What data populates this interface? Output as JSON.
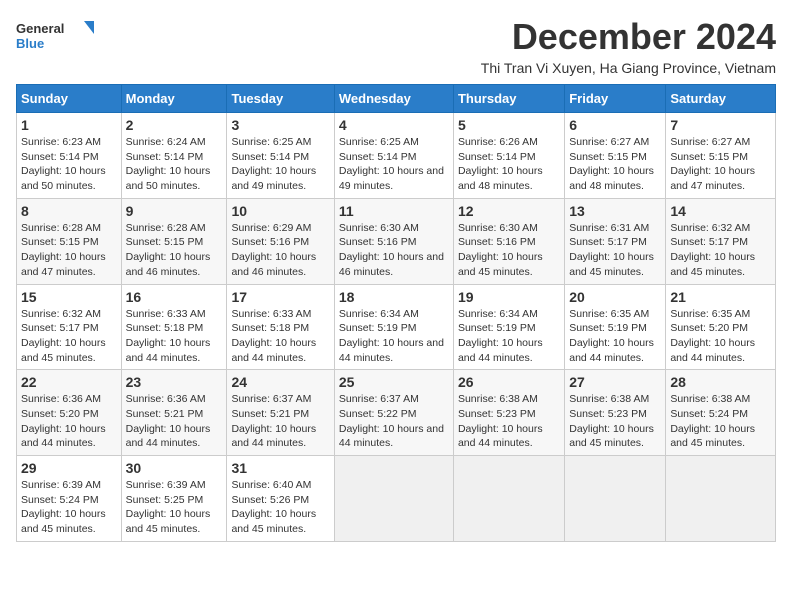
{
  "logo": {
    "text_general": "General",
    "text_blue": "Blue"
  },
  "header": {
    "month_year": "December 2024",
    "location": "Thi Tran Vi Xuyen, Ha Giang Province, Vietnam"
  },
  "weekdays": [
    "Sunday",
    "Monday",
    "Tuesday",
    "Wednesday",
    "Thursday",
    "Friday",
    "Saturday"
  ],
  "weeks": [
    [
      {
        "day": "1",
        "sunrise": "6:23 AM",
        "sunset": "5:14 PM",
        "daylight": "10 hours and 50 minutes."
      },
      {
        "day": "2",
        "sunrise": "6:24 AM",
        "sunset": "5:14 PM",
        "daylight": "10 hours and 50 minutes."
      },
      {
        "day": "3",
        "sunrise": "6:25 AM",
        "sunset": "5:14 PM",
        "daylight": "10 hours and 49 minutes."
      },
      {
        "day": "4",
        "sunrise": "6:25 AM",
        "sunset": "5:14 PM",
        "daylight": "10 hours and 49 minutes."
      },
      {
        "day": "5",
        "sunrise": "6:26 AM",
        "sunset": "5:14 PM",
        "daylight": "10 hours and 48 minutes."
      },
      {
        "day": "6",
        "sunrise": "6:27 AM",
        "sunset": "5:15 PM",
        "daylight": "10 hours and 48 minutes."
      },
      {
        "day": "7",
        "sunrise": "6:27 AM",
        "sunset": "5:15 PM",
        "daylight": "10 hours and 47 minutes."
      }
    ],
    [
      {
        "day": "8",
        "sunrise": "6:28 AM",
        "sunset": "5:15 PM",
        "daylight": "10 hours and 47 minutes."
      },
      {
        "day": "9",
        "sunrise": "6:28 AM",
        "sunset": "5:15 PM",
        "daylight": "10 hours and 46 minutes."
      },
      {
        "day": "10",
        "sunrise": "6:29 AM",
        "sunset": "5:16 PM",
        "daylight": "10 hours and 46 minutes."
      },
      {
        "day": "11",
        "sunrise": "6:30 AM",
        "sunset": "5:16 PM",
        "daylight": "10 hours and 46 minutes."
      },
      {
        "day": "12",
        "sunrise": "6:30 AM",
        "sunset": "5:16 PM",
        "daylight": "10 hours and 45 minutes."
      },
      {
        "day": "13",
        "sunrise": "6:31 AM",
        "sunset": "5:17 PM",
        "daylight": "10 hours and 45 minutes."
      },
      {
        "day": "14",
        "sunrise": "6:32 AM",
        "sunset": "5:17 PM",
        "daylight": "10 hours and 45 minutes."
      }
    ],
    [
      {
        "day": "15",
        "sunrise": "6:32 AM",
        "sunset": "5:17 PM",
        "daylight": "10 hours and 45 minutes."
      },
      {
        "day": "16",
        "sunrise": "6:33 AM",
        "sunset": "5:18 PM",
        "daylight": "10 hours and 44 minutes."
      },
      {
        "day": "17",
        "sunrise": "6:33 AM",
        "sunset": "5:18 PM",
        "daylight": "10 hours and 44 minutes."
      },
      {
        "day": "18",
        "sunrise": "6:34 AM",
        "sunset": "5:19 PM",
        "daylight": "10 hours and 44 minutes."
      },
      {
        "day": "19",
        "sunrise": "6:34 AM",
        "sunset": "5:19 PM",
        "daylight": "10 hours and 44 minutes."
      },
      {
        "day": "20",
        "sunrise": "6:35 AM",
        "sunset": "5:19 PM",
        "daylight": "10 hours and 44 minutes."
      },
      {
        "day": "21",
        "sunrise": "6:35 AM",
        "sunset": "5:20 PM",
        "daylight": "10 hours and 44 minutes."
      }
    ],
    [
      {
        "day": "22",
        "sunrise": "6:36 AM",
        "sunset": "5:20 PM",
        "daylight": "10 hours and 44 minutes."
      },
      {
        "day": "23",
        "sunrise": "6:36 AM",
        "sunset": "5:21 PM",
        "daylight": "10 hours and 44 minutes."
      },
      {
        "day": "24",
        "sunrise": "6:37 AM",
        "sunset": "5:21 PM",
        "daylight": "10 hours and 44 minutes."
      },
      {
        "day": "25",
        "sunrise": "6:37 AM",
        "sunset": "5:22 PM",
        "daylight": "10 hours and 44 minutes."
      },
      {
        "day": "26",
        "sunrise": "6:38 AM",
        "sunset": "5:23 PM",
        "daylight": "10 hours and 44 minutes."
      },
      {
        "day": "27",
        "sunrise": "6:38 AM",
        "sunset": "5:23 PM",
        "daylight": "10 hours and 45 minutes."
      },
      {
        "day": "28",
        "sunrise": "6:38 AM",
        "sunset": "5:24 PM",
        "daylight": "10 hours and 45 minutes."
      }
    ],
    [
      {
        "day": "29",
        "sunrise": "6:39 AM",
        "sunset": "5:24 PM",
        "daylight": "10 hours and 45 minutes."
      },
      {
        "day": "30",
        "sunrise": "6:39 AM",
        "sunset": "5:25 PM",
        "daylight": "10 hours and 45 minutes."
      },
      {
        "day": "31",
        "sunrise": "6:40 AM",
        "sunset": "5:26 PM",
        "daylight": "10 hours and 45 minutes."
      },
      null,
      null,
      null,
      null
    ]
  ]
}
